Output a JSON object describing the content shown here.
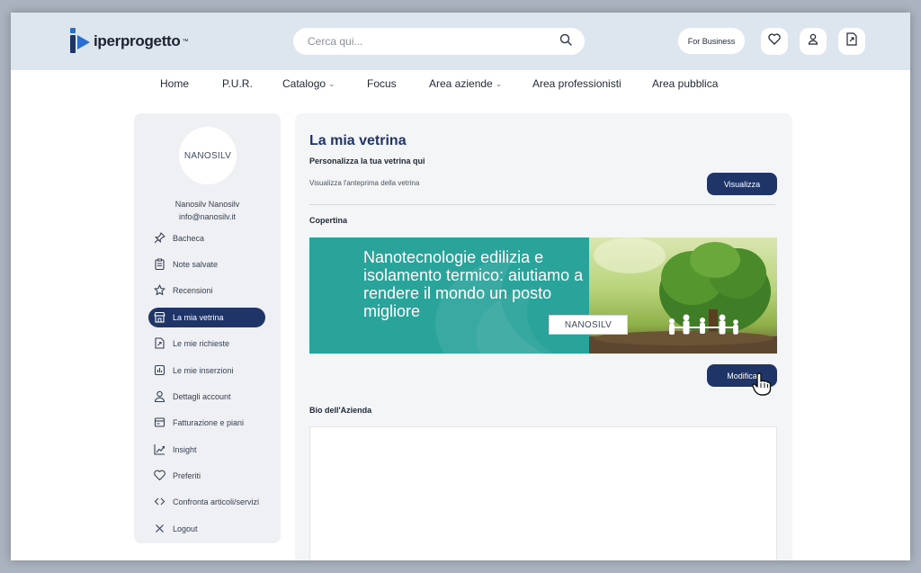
{
  "header": {
    "logo_text": "iperprogetto",
    "logo_tm": "™",
    "search_placeholder": "Cerca qui...",
    "for_business": "For Business"
  },
  "nav": {
    "items": [
      {
        "label": "Home"
      },
      {
        "label": "P.U.R."
      },
      {
        "label": "Catalogo",
        "dropdown": true
      },
      {
        "label": "Focus"
      },
      {
        "label": "Area aziende",
        "dropdown": true
      },
      {
        "label": "Area professionisti"
      },
      {
        "label": "Area pubblica"
      }
    ]
  },
  "sidebar": {
    "avatar_text": "NANOSILV",
    "user_name": "Nanosilv Nanosilv",
    "user_email": "info@nanosilv.it",
    "items": [
      {
        "label": "Bacheca",
        "icon": "pin-icon"
      },
      {
        "label": "Note salvate",
        "icon": "clipboard-icon"
      },
      {
        "label": "Recensioni",
        "icon": "star-icon"
      },
      {
        "label": "La mia vetrina",
        "icon": "storefront-icon",
        "active": true
      },
      {
        "label": "Le mie richieste",
        "icon": "document-export-icon"
      },
      {
        "label": "Le mie inserzioni",
        "icon": "bar-chart-icon"
      },
      {
        "label": "Dettagli account",
        "icon": "user-icon"
      },
      {
        "label": "Fatturazione e piani",
        "icon": "billing-icon"
      },
      {
        "label": "Insight",
        "icon": "trend-icon"
      },
      {
        "label": "Preferiti",
        "icon": "heart-icon"
      },
      {
        "label": "Confronta articoli/servizi",
        "icon": "compare-icon"
      },
      {
        "label": "Logout",
        "icon": "close-icon"
      }
    ]
  },
  "main": {
    "title": "La mia vetrina",
    "subtitle": "Personalizza la tua vetrina qui",
    "preview_text": "Visualizza l'anteprima della vetrina",
    "visualizza_label": "Visualizza",
    "cover_label": "Copertina",
    "cover_headline": "Nanotecnologie edilizia e isolamento termico: aiutiamo a rendere il mondo un posto migliore",
    "cover_logo_text": "NANOSILV",
    "modifica_label": "Modifica",
    "bio_label": "Bio dell'Azienda"
  },
  "colors": {
    "primary": "#1f3467",
    "header_bg": "#dde5ee",
    "teal": "#2aa39a"
  }
}
